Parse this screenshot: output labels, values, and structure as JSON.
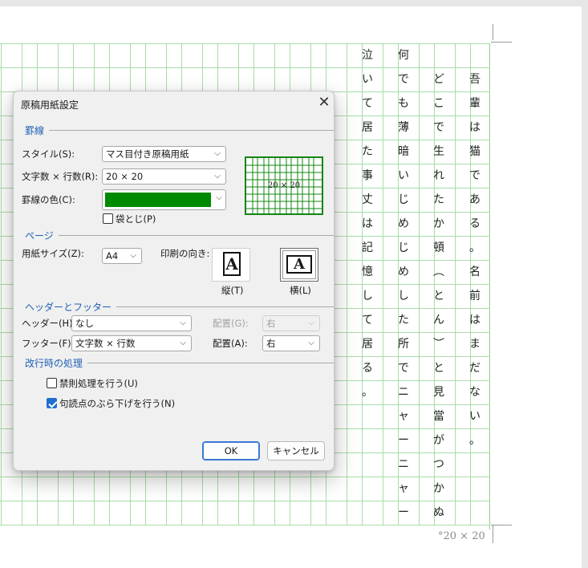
{
  "document": {
    "footer_note": "°20 × 20",
    "columns": [
      [
        "泣",
        "い",
        "て",
        "居",
        "た",
        "事",
        "丈",
        "は",
        "記",
        "憶",
        "し",
        "て",
        "居",
        "る",
        "。"
      ],
      [
        "何",
        "で",
        "も",
        "薄",
        "暗",
        "い",
        "じ",
        "め",
        "じ",
        "め",
        "し",
        "た",
        "所",
        "で",
        "ニ",
        "ャ",
        "ー",
        "ニ",
        "ャ",
        "ー"
      ],
      [
        "",
        "ど",
        "こ",
        "で",
        "生",
        "れ",
        "た",
        "か",
        "頓",
        "︵",
        "と",
        "ん",
        "︶",
        "と",
        "見",
        "當",
        "が",
        "つ",
        "か",
        "ぬ"
      ],
      [
        "",
        "吾",
        "輩",
        "は",
        "猫",
        "で",
        "あ",
        "る",
        "。",
        "名",
        "前",
        "は",
        "ま",
        "だ",
        "な",
        "い",
        "。"
      ]
    ]
  },
  "dialog": {
    "title": "原稿用紙設定",
    "close_glyph": "✕",
    "sections": {
      "lines": "罫線",
      "page": "ページ",
      "header_footer": "ヘッダーとフッター",
      "line_break": "改行時の処理"
    },
    "style_label": "スタイル(S):",
    "style_value": "マス目付き原稿用紙",
    "grid_label": "文字数 × 行数(R):",
    "grid_value": "20 × 20",
    "line_color_label": "罫線の色(C):",
    "line_color": "#008a00",
    "fukuro_label": "袋とじ(P)",
    "fukuro_checked": false,
    "preview_text": "20 × 20",
    "paper_size_label": "用紙サイズ(Z):",
    "paper_size_value": "A4",
    "orientation_label": "印刷の向き:",
    "portrait_label": "縦(T)",
    "landscape_label": "横(L)",
    "orientation_glyph": "A",
    "orientation_selected": "landscape",
    "header_label": "ヘッダー(H):",
    "header_value": "なし",
    "header_position_label": "配置(G):",
    "header_position_value": "右",
    "footer_label": "フッター(F):",
    "footer_value": "文字数 × 行数",
    "footer_position_label": "配置(A):",
    "footer_position_value": "右",
    "kinsoku_label": "禁則処理を行う(U)",
    "kinsoku_checked": false,
    "burasage_label": "句読点のぶら下げを行う(N)",
    "burasage_checked": true,
    "ok_label": "OK",
    "cancel_label": "キャンセル",
    "dropdown_arrow": "⌵"
  }
}
